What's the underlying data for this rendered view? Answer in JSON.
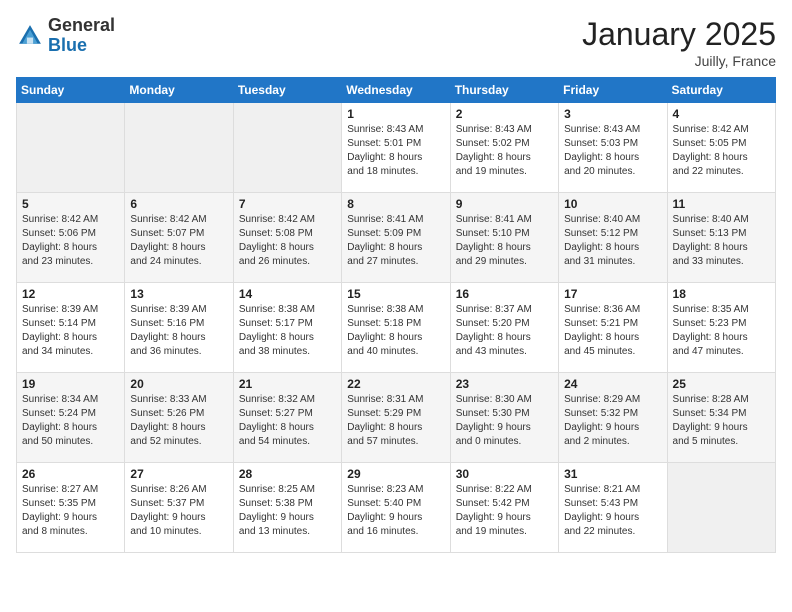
{
  "header": {
    "logo": {
      "general": "General",
      "blue": "Blue"
    },
    "title": "January 2025",
    "location": "Juilly, France"
  },
  "weekdays": [
    "Sunday",
    "Monday",
    "Tuesday",
    "Wednesday",
    "Thursday",
    "Friday",
    "Saturday"
  ],
  "weeks": [
    [
      {
        "day": "",
        "info": ""
      },
      {
        "day": "",
        "info": ""
      },
      {
        "day": "",
        "info": ""
      },
      {
        "day": "1",
        "info": "Sunrise: 8:43 AM\nSunset: 5:01 PM\nDaylight: 8 hours\nand 18 minutes."
      },
      {
        "day": "2",
        "info": "Sunrise: 8:43 AM\nSunset: 5:02 PM\nDaylight: 8 hours\nand 19 minutes."
      },
      {
        "day": "3",
        "info": "Sunrise: 8:43 AM\nSunset: 5:03 PM\nDaylight: 8 hours\nand 20 minutes."
      },
      {
        "day": "4",
        "info": "Sunrise: 8:42 AM\nSunset: 5:05 PM\nDaylight: 8 hours\nand 22 minutes."
      }
    ],
    [
      {
        "day": "5",
        "info": "Sunrise: 8:42 AM\nSunset: 5:06 PM\nDaylight: 8 hours\nand 23 minutes."
      },
      {
        "day": "6",
        "info": "Sunrise: 8:42 AM\nSunset: 5:07 PM\nDaylight: 8 hours\nand 24 minutes."
      },
      {
        "day": "7",
        "info": "Sunrise: 8:42 AM\nSunset: 5:08 PM\nDaylight: 8 hours\nand 26 minutes."
      },
      {
        "day": "8",
        "info": "Sunrise: 8:41 AM\nSunset: 5:09 PM\nDaylight: 8 hours\nand 27 minutes."
      },
      {
        "day": "9",
        "info": "Sunrise: 8:41 AM\nSunset: 5:10 PM\nDaylight: 8 hours\nand 29 minutes."
      },
      {
        "day": "10",
        "info": "Sunrise: 8:40 AM\nSunset: 5:12 PM\nDaylight: 8 hours\nand 31 minutes."
      },
      {
        "day": "11",
        "info": "Sunrise: 8:40 AM\nSunset: 5:13 PM\nDaylight: 8 hours\nand 33 minutes."
      }
    ],
    [
      {
        "day": "12",
        "info": "Sunrise: 8:39 AM\nSunset: 5:14 PM\nDaylight: 8 hours\nand 34 minutes."
      },
      {
        "day": "13",
        "info": "Sunrise: 8:39 AM\nSunset: 5:16 PM\nDaylight: 8 hours\nand 36 minutes."
      },
      {
        "day": "14",
        "info": "Sunrise: 8:38 AM\nSunset: 5:17 PM\nDaylight: 8 hours\nand 38 minutes."
      },
      {
        "day": "15",
        "info": "Sunrise: 8:38 AM\nSunset: 5:18 PM\nDaylight: 8 hours\nand 40 minutes."
      },
      {
        "day": "16",
        "info": "Sunrise: 8:37 AM\nSunset: 5:20 PM\nDaylight: 8 hours\nand 43 minutes."
      },
      {
        "day": "17",
        "info": "Sunrise: 8:36 AM\nSunset: 5:21 PM\nDaylight: 8 hours\nand 45 minutes."
      },
      {
        "day": "18",
        "info": "Sunrise: 8:35 AM\nSunset: 5:23 PM\nDaylight: 8 hours\nand 47 minutes."
      }
    ],
    [
      {
        "day": "19",
        "info": "Sunrise: 8:34 AM\nSunset: 5:24 PM\nDaylight: 8 hours\nand 50 minutes."
      },
      {
        "day": "20",
        "info": "Sunrise: 8:33 AM\nSunset: 5:26 PM\nDaylight: 8 hours\nand 52 minutes."
      },
      {
        "day": "21",
        "info": "Sunrise: 8:32 AM\nSunset: 5:27 PM\nDaylight: 8 hours\nand 54 minutes."
      },
      {
        "day": "22",
        "info": "Sunrise: 8:31 AM\nSunset: 5:29 PM\nDaylight: 8 hours\nand 57 minutes."
      },
      {
        "day": "23",
        "info": "Sunrise: 8:30 AM\nSunset: 5:30 PM\nDaylight: 9 hours\nand 0 minutes."
      },
      {
        "day": "24",
        "info": "Sunrise: 8:29 AM\nSunset: 5:32 PM\nDaylight: 9 hours\nand 2 minutes."
      },
      {
        "day": "25",
        "info": "Sunrise: 8:28 AM\nSunset: 5:34 PM\nDaylight: 9 hours\nand 5 minutes."
      }
    ],
    [
      {
        "day": "26",
        "info": "Sunrise: 8:27 AM\nSunset: 5:35 PM\nDaylight: 9 hours\nand 8 minutes."
      },
      {
        "day": "27",
        "info": "Sunrise: 8:26 AM\nSunset: 5:37 PM\nDaylight: 9 hours\nand 10 minutes."
      },
      {
        "day": "28",
        "info": "Sunrise: 8:25 AM\nSunset: 5:38 PM\nDaylight: 9 hours\nand 13 minutes."
      },
      {
        "day": "29",
        "info": "Sunrise: 8:23 AM\nSunset: 5:40 PM\nDaylight: 9 hours\nand 16 minutes."
      },
      {
        "day": "30",
        "info": "Sunrise: 8:22 AM\nSunset: 5:42 PM\nDaylight: 9 hours\nand 19 minutes."
      },
      {
        "day": "31",
        "info": "Sunrise: 8:21 AM\nSunset: 5:43 PM\nDaylight: 9 hours\nand 22 minutes."
      },
      {
        "day": "",
        "info": ""
      }
    ]
  ]
}
